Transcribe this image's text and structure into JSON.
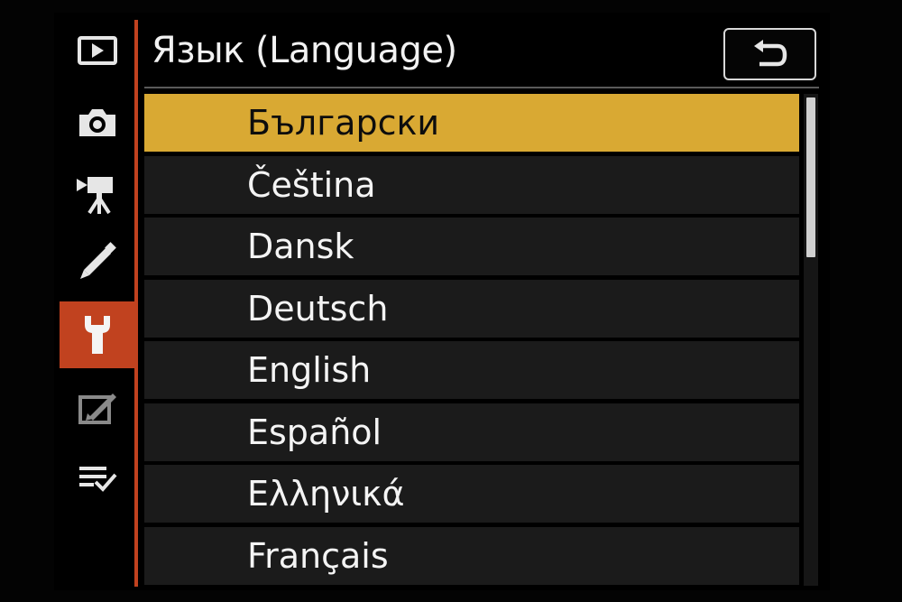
{
  "colors": {
    "accent": "#c1421f",
    "highlight": "#d9a933",
    "icon": "#e6e6e6",
    "icon_dim": "#8a8a8a"
  },
  "sidebar": {
    "items": [
      {
        "icon": "playback-icon",
        "active": false
      },
      {
        "icon": "camera-icon",
        "active": false
      },
      {
        "icon": "movie-camera-icon",
        "active": false
      },
      {
        "icon": "pencil-icon",
        "active": false
      },
      {
        "icon": "wrench-icon",
        "active": true
      },
      {
        "icon": "retouch-icon",
        "active": false
      },
      {
        "icon": "my-menu-icon",
        "active": false
      }
    ]
  },
  "header": {
    "title": "Язык (Language)",
    "back_icon": "return-arrow-icon"
  },
  "languages": {
    "selected_index": 0,
    "items": [
      "Български",
      "Čeština",
      "Dansk",
      "Deutsch",
      "English",
      "Español",
      "Ελληνικά",
      "Français"
    ]
  },
  "scrollbar": {
    "visible_fraction": 0.33,
    "position": 0.0
  }
}
